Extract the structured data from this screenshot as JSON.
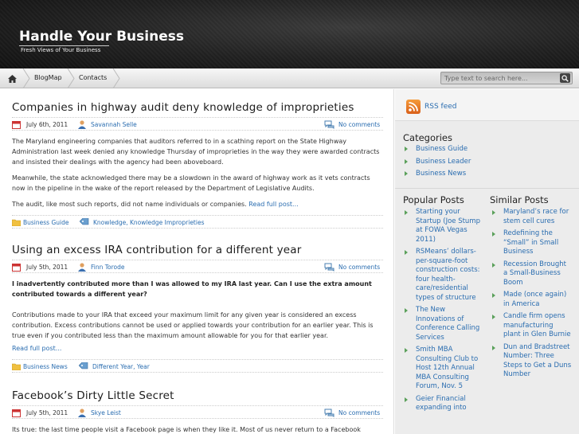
{
  "site": {
    "title": "Handle Your Business",
    "tagline": "Fresh Views of Your Business"
  },
  "nav": {
    "items": [
      "BlogMap",
      "Contacts"
    ],
    "search_placeholder": "Type text to search here..."
  },
  "posts": [
    {
      "title": "Companies in highway audit deny knowledge of improprieties",
      "date": "July 6th, 2011",
      "author": "Savannah Selle",
      "comments": "No comments",
      "paragraphs": [
        "The Maryland engineering companies that auditors referred to in a scathing report on the State Highway Administration last week denied any knowledge Thursday of improprieties in the way they were awarded contracts and insisted their dealings with the agency had been aboveboard.",
        "Meanwhile, the state acknowledged there may be a slowdown in the award of highway work as it vets contracts now in the pipeline in the wake of the report released by the Department of Legislative Audits.",
        "The audit, like most such reports, did not name individuals or companies."
      ],
      "read_more": "Read full post...",
      "category": "Business Guide",
      "tags": "Knowledge, Knowledge Improprieties"
    },
    {
      "title": "Using an excess IRA contribution for a different year",
      "date": "July 5th, 2011",
      "author": "Finn Torode",
      "comments": "No comments",
      "lead": "I inadvertently contributed more than I was allowed to my IRA last year. Can I use the extra amount contributed towards a different year?",
      "paragraphs": [
        "Contributions made to your IRA that exceed your maximum limit for any given year is considered an excess contribution. Excess contributions cannot be used or applied towards your contribution for an earlier year. This is true even if you contributed less than the maximum amount allowable for you for that earlier year."
      ],
      "read_more": "Read full post...",
      "category": "Business News",
      "tags": "Different Year, Year"
    },
    {
      "title": "Facebook’s Dirty Little Secret",
      "date": "July 5th, 2011",
      "author": "Skye Leist",
      "comments": "No comments",
      "paragraphs": [
        "Its true: the last time people visit a Facebook page is when they like it. Most of us never return to a Facebook"
      ]
    }
  ],
  "sidebar": {
    "rss": "RSS feed",
    "categories_title": "Categories",
    "categories": [
      "Business Guide",
      "Business Leader",
      "Business News"
    ],
    "popular_title": "Popular Posts",
    "popular": [
      "Starting your Startup (Joe Stump at FOWA Vegas 2011)",
      "RSMeans’ dollars-per-square-foot construction costs: four health-care/residential types of structure",
      "The New Innovations of Conference Calling Services",
      "Smith MBA Consulting Club to Host 12th Annual MBA Consulting Forum, Nov. 5",
      "Geier Financial expanding into"
    ],
    "similar_title": "Similar Posts",
    "similar": [
      "Maryland’s race for stem cell cures",
      "Redefining the “Small” in Small Business",
      "Recession Brought a Small-Business Boom",
      "Made (once again) in America",
      "Candle firm opens manufacturing plant in Glen Burnie",
      "Dun and Bradstreet Number: Three Steps to Get a Duns Number"
    ]
  },
  "colors": {
    "link": "#2a6db0",
    "bullet": "#5aa05a",
    "header": "#202020"
  }
}
